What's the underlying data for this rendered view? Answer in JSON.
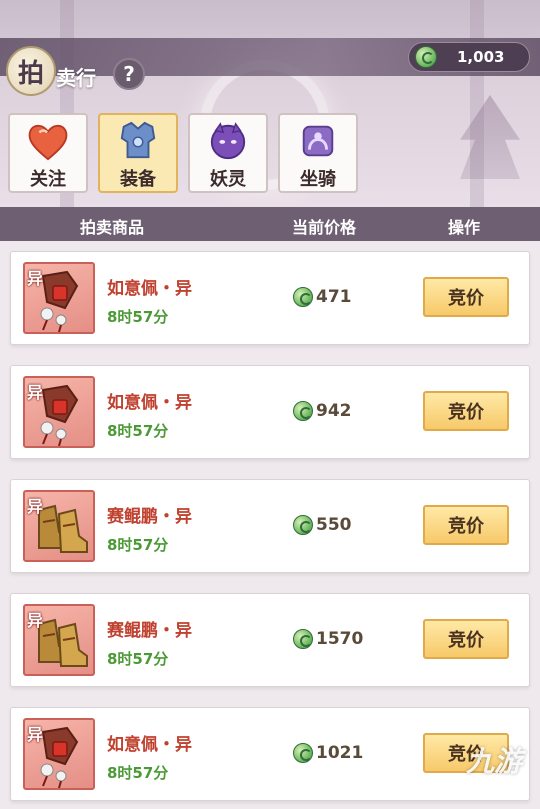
{
  "header": {
    "title_first": "拍",
    "title_rest": "卖行",
    "help": "?",
    "currency": {
      "icon": "jade-coin-icon",
      "value": "1,003"
    }
  },
  "tabs": [
    {
      "label": "关注",
      "icon": "heart-icon",
      "active": false
    },
    {
      "label": "装备",
      "icon": "armor-icon",
      "active": true
    },
    {
      "label": "妖灵",
      "icon": "spirit-icon",
      "active": false
    },
    {
      "label": "坐骑",
      "icon": "mount-icon",
      "active": false
    }
  ],
  "columns": {
    "item": "拍卖商品",
    "price": "当前价格",
    "action": "操作"
  },
  "items": [
    {
      "tag": "异",
      "name": "如意佩・异",
      "time": "8时57分",
      "price": "471",
      "button": "竞价",
      "icon": "jade-pendant-icon"
    },
    {
      "tag": "异",
      "name": "如意佩・异",
      "time": "8时57分",
      "price": "942",
      "button": "竞价",
      "icon": "jade-pendant-icon"
    },
    {
      "tag": "异",
      "name": "赛鲲鹏・异",
      "time": "8时57分",
      "price": "550",
      "button": "竞价",
      "icon": "boots-icon"
    },
    {
      "tag": "异",
      "name": "赛鲲鹏・异",
      "time": "8时57分",
      "price": "1570",
      "button": "竞价",
      "icon": "boots-icon"
    },
    {
      "tag": "异",
      "name": "如意佩・异",
      "time": "8时57分",
      "price": "1021",
      "button": "竞价",
      "icon": "jade-pendant-icon"
    }
  ],
  "watermark": "九游",
  "colors": {
    "accent_gold": "#f7c96a",
    "name_red": "#c0412f",
    "time_green": "#4c9a36",
    "header_purple": "#6e5f73"
  }
}
